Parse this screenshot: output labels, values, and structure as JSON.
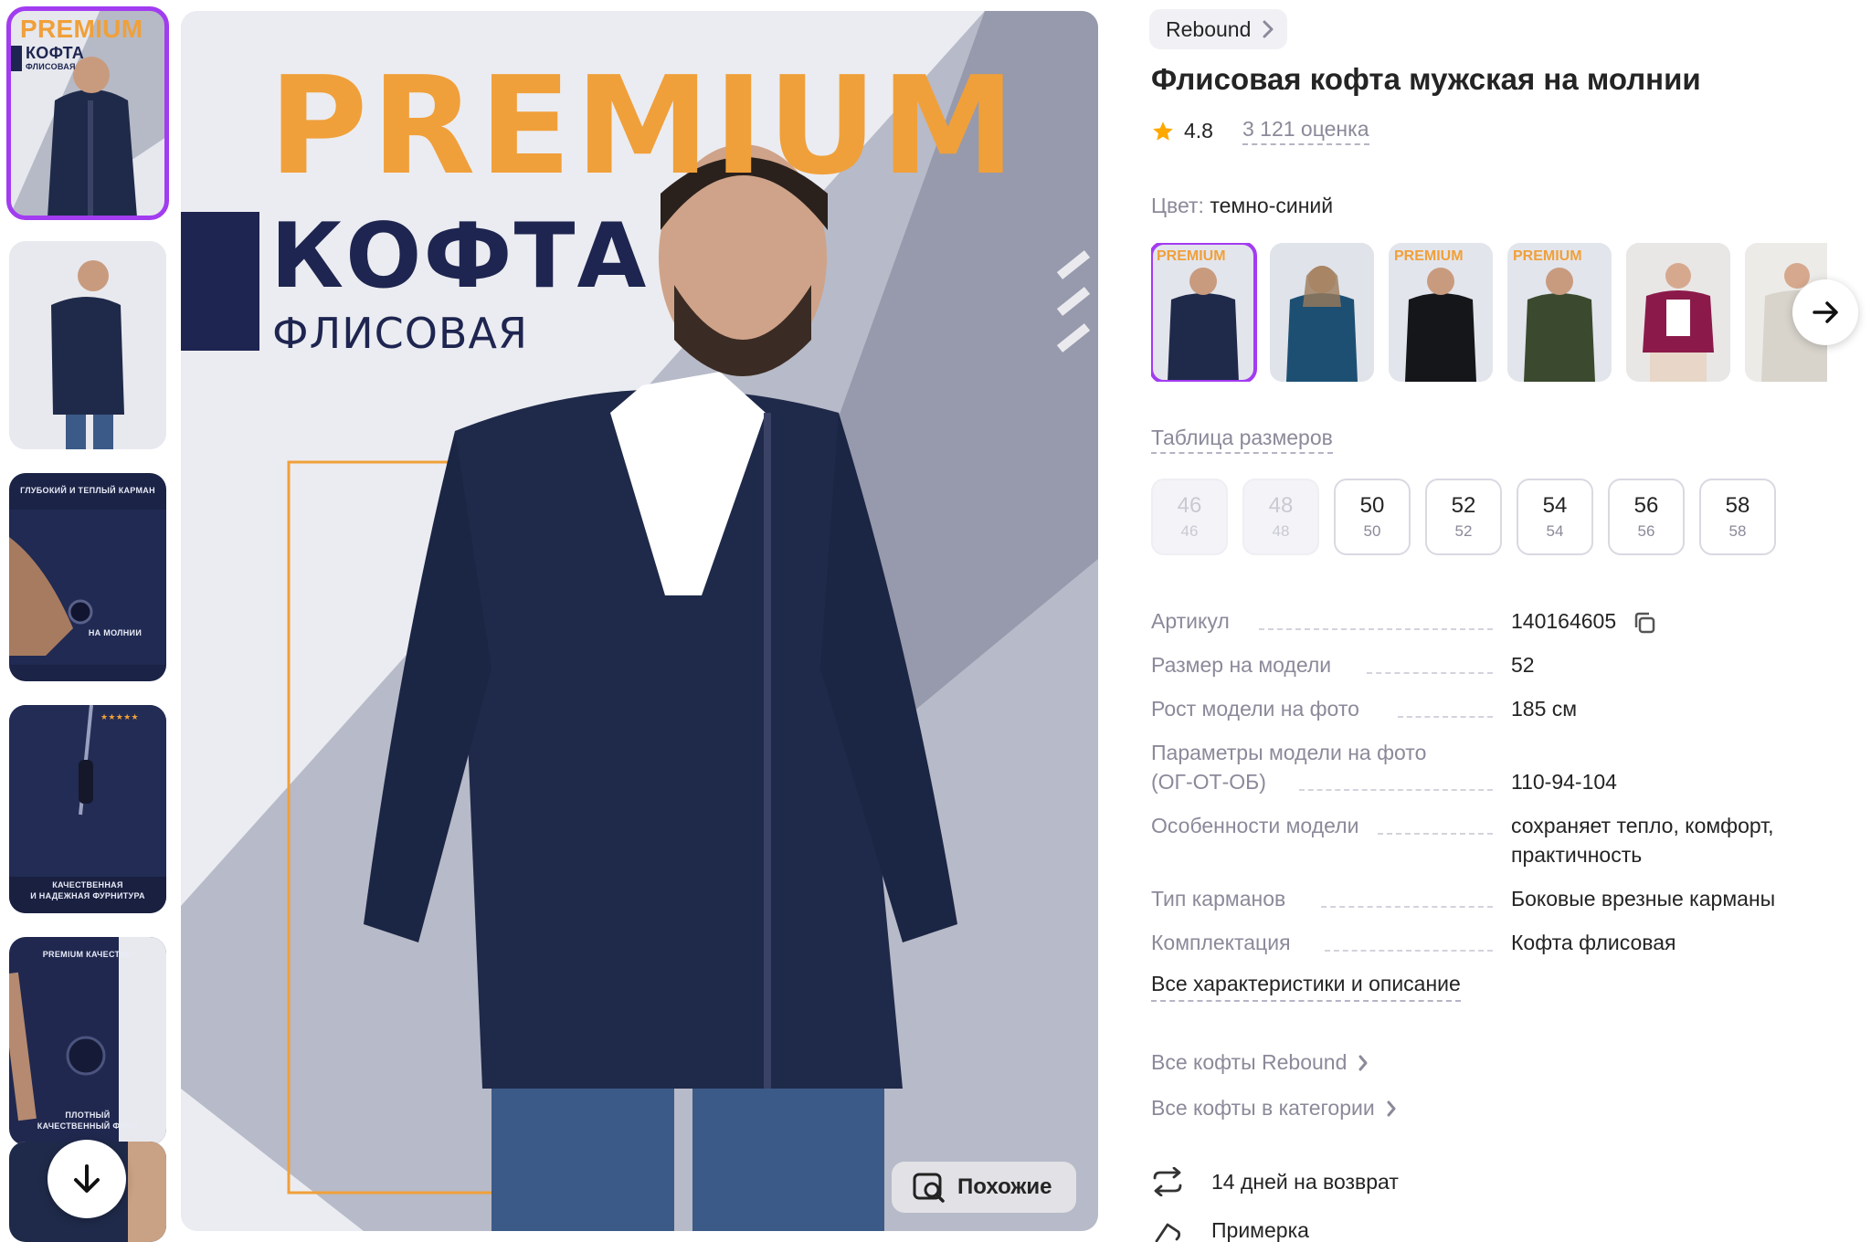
{
  "main_image": {
    "premium_text": "PREMIUM",
    "kofta_text": "КОФТА",
    "fleece_text": "ФЛИСОВАЯ",
    "similar_button": "Похожие"
  },
  "thumbnails": [
    {
      "name": "thumb-1",
      "caption_top": "PREMIUM",
      "caption_mid": "КОФТА",
      "caption_small": "ФЛИСОВАЯ",
      "active": true
    },
    {
      "name": "thumb-2",
      "caption_top": "",
      "caption_mid": "",
      "caption_small": "",
      "active": false
    },
    {
      "name": "thumb-3",
      "caption_top": "ГЛУБОКИЙ И ТЕПЛЫЙ КАРМАН",
      "caption_mid": "НА МОЛНИИ",
      "caption_small": "",
      "active": false
    },
    {
      "name": "thumb-4",
      "caption_top": "★★★★★",
      "caption_mid": "КАЧЕСТВЕННАЯ",
      "caption_small": "И НАДЕЖНАЯ ФУРНИТУРА",
      "active": false
    },
    {
      "name": "thumb-5",
      "caption_top": "PREMIUM КАЧЕСТВО",
      "caption_mid": "ПЛОТНЫЙ",
      "caption_small": "КАЧЕСТВЕННЫЙ ФЛИС",
      "active": false
    }
  ],
  "product": {
    "brand": "Rebound",
    "title": "Флисовая кофта мужская на молнии",
    "rating": "4.8",
    "reviews": "3 121 оценка",
    "color_label": "Цвет:",
    "color_value": "темно-синий",
    "size_table_link": "Таблица размеров"
  },
  "swatches": [
    {
      "color": "#1f2a4a",
      "label": "PREMIUM",
      "active": true
    },
    {
      "color": "#1d4f72",
      "label": "",
      "active": false
    },
    {
      "color": "#15161a",
      "label": "PREMIUM",
      "active": false
    },
    {
      "color": "#3b4a2e",
      "label": "PREMIUM",
      "active": false
    },
    {
      "color": "#8b1a4a",
      "label": "",
      "active": false
    },
    {
      "color": "#d8d4cc",
      "label": "",
      "active": false
    }
  ],
  "sizes": [
    {
      "main": "46",
      "sub": "46",
      "available": false
    },
    {
      "main": "48",
      "sub": "48",
      "available": false
    },
    {
      "main": "50",
      "sub": "50",
      "available": true
    },
    {
      "main": "52",
      "sub": "52",
      "available": true
    },
    {
      "main": "54",
      "sub": "54",
      "available": true
    },
    {
      "main": "56",
      "sub": "56",
      "available": true
    },
    {
      "main": "58",
      "sub": "58",
      "available": true
    }
  ],
  "specs": [
    {
      "key": "Артикул",
      "key2": "",
      "value": "140164605"
    },
    {
      "key": "Размер на модели",
      "key2": "",
      "value": "52"
    },
    {
      "key": "Рост модели на фото",
      "key2": "",
      "value": "185 см"
    },
    {
      "key": "Параметры модели на фото",
      "key2": "(ОГ-ОТ-ОБ)",
      "value": "110-94-104"
    },
    {
      "key": "Особенности модели",
      "key2": "",
      "value": "сохраняет тепло, комфорт, практичность"
    },
    {
      "key": "Тип карманов",
      "key2": "",
      "value": "Боковые врезные карманы"
    },
    {
      "key": "Комплектация",
      "key2": "",
      "value": "Кофта флисовая"
    }
  ],
  "links": {
    "all_specs": "Все характеристики и описание",
    "all_brand": "Все кофты Rebound",
    "all_category": "Все кофты в категории"
  },
  "perks": {
    "return": "14 дней на возврат",
    "fitting": "Примерка"
  },
  "colors": {
    "accent": "#a23cf0",
    "premium_orange": "#f0a03a",
    "navy": "#1e2550",
    "star": "#ffa800"
  }
}
